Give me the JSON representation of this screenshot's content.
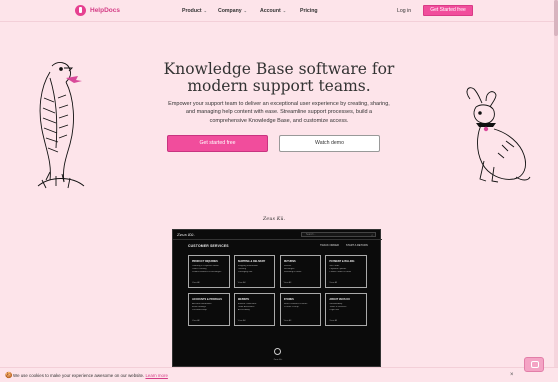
{
  "brand": {
    "name": "HelpDocs"
  },
  "nav": {
    "items": [
      {
        "label": "Product",
        "has_dropdown": true
      },
      {
        "label": "Company",
        "has_dropdown": true
      },
      {
        "label": "Account",
        "has_dropdown": true
      },
      {
        "label": "Pricing",
        "has_dropdown": false
      }
    ],
    "login": "Log in",
    "cta": "Get Started free"
  },
  "hero": {
    "title": "Knowledge Base software for modern support teams.",
    "lead": "Empower your support team to deliver an exceptional user experience by creating, sharing, and managing help content with ease. Streamline support processes, build a comprehensive Knowledge Base, and customize access.",
    "primary_cta": "Get started free",
    "secondary_cta": "Watch demo"
  },
  "preview": {
    "tag": "Zeus Kü.",
    "brand": "Zeus Kü.",
    "search_placeholder": "Search…",
    "heading": "CUSTOMER SERVICES",
    "tools": [
      "TRACK ORDER",
      "START A RETURN"
    ],
    "cards": [
      {
        "title": "PRODUCT INQUIRIES",
        "lines": [
          "Ordering & Payment Status",
          "Order Tracking",
          "Product Returns & Exchanges"
        ],
        "foot": "View All"
      },
      {
        "title": "SHIPPING & DELIVERY",
        "lines": [
          "Shipping Information",
          "Tracking",
          "Packaging Info"
        ],
        "foot": "View All"
      },
      {
        "title": "RETURNS",
        "lines": [
          "Returns",
          "Exchanges",
          "Returning to Store"
        ],
        "foot": "View All"
      },
      {
        "title": "PAYMENT & BILLING",
        "lines": [
          "Gift Cards",
          "Payment Options",
          "Promo Codes & Deals"
        ],
        "foot": "View All"
      },
      {
        "title": "ACCOUNTS & PROFILES",
        "lines": [
          "Account Information",
          "Email Settings",
          "Password Help"
        ],
        "foot": "View All"
      },
      {
        "title": "WEBSITE",
        "lines": [
          "Browse Collections",
          "Order Assistance",
          "Accessibility"
        ],
        "foot": "View All"
      },
      {
        "title": "STORES",
        "lines": [
          "Store Locations & Hours",
          "In-Store Pickup"
        ],
        "foot": "View All"
      },
      {
        "title": "ABOUT ZEUS KÜ",
        "lines": [
          "Sustainability",
          "Terms & Services",
          "Legal Info"
        ],
        "foot": "View All"
      }
    ],
    "footer_text": "Zeus Kü."
  },
  "cookie": {
    "icon": "cookie-icon",
    "text": "We use cookies to make your experience awesome on our website.",
    "link": "Learn more",
    "close": "×"
  },
  "colors": {
    "accent": "#f14d9c",
    "background": "#fde4ea",
    "preview_bg": "#0b0b0b"
  }
}
